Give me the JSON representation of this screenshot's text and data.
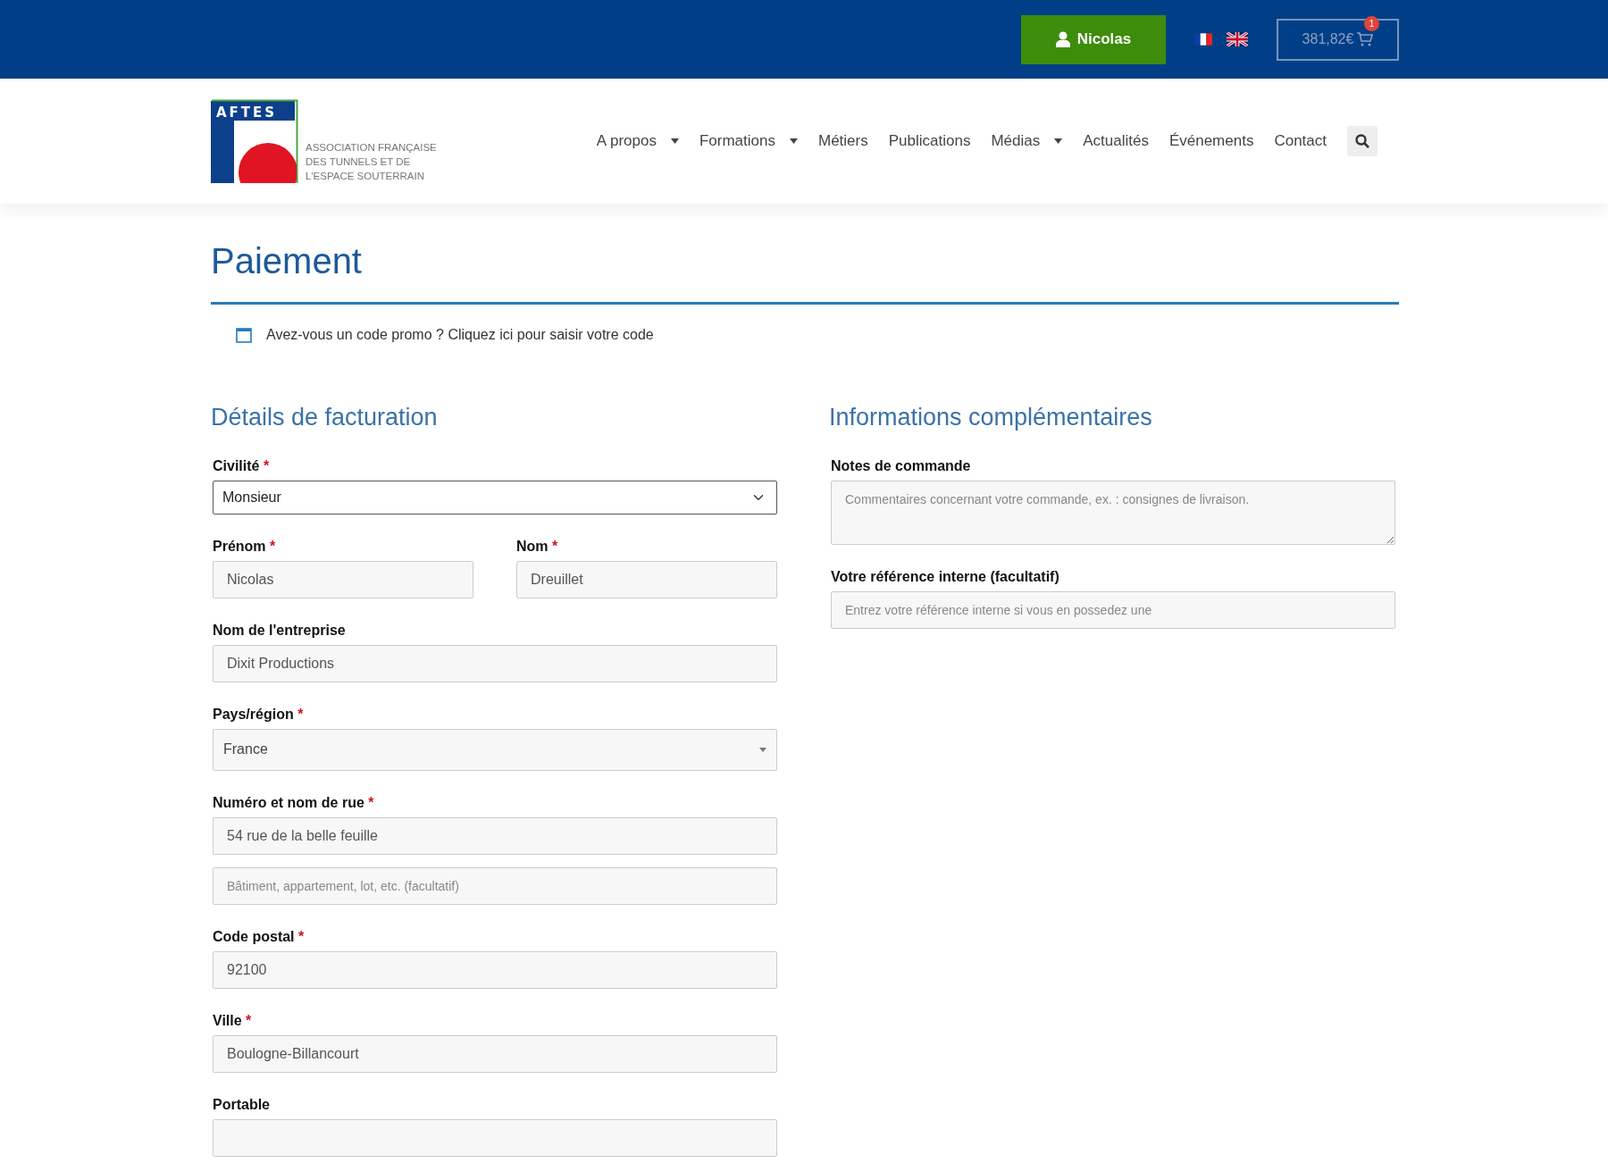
{
  "topbar": {
    "user_button": "Nicolas",
    "languages": [
      {
        "kind": "french"
      },
      {
        "kind": "english"
      }
    ],
    "cart": {
      "total": "381,82€",
      "count": "1"
    }
  },
  "header": {
    "logo": {
      "acronym": "AFTES",
      "lines": [
        "ASSOCIATION FRANÇAISE",
        "DES TUNNELS ET DE",
        "L'ESPACE SOUTERRAIN"
      ]
    },
    "nav": [
      {
        "label": "A propos",
        "has_menu": true
      },
      {
        "label": "Formations",
        "has_menu": true
      },
      {
        "label": "Métiers",
        "has_menu": false
      },
      {
        "label": "Publications",
        "has_menu": false
      },
      {
        "label": "Médias",
        "has_menu": true
      },
      {
        "label": "Actualités",
        "has_menu": false
      },
      {
        "label": "Événements",
        "has_menu": false
      },
      {
        "label": "Contact",
        "has_menu": false
      }
    ]
  },
  "page": {
    "title": "Paiement",
    "promo_notice": "Avez-vous un code promo ? Cliquez ici pour saisir votre code"
  },
  "billing": {
    "heading": "Détails de facturation",
    "rows": [
      {
        "fields": [
          {
            "kind": "select",
            "label": "Civilité",
            "mark": "*",
            "value": "Monsieur"
          }
        ]
      },
      {
        "fields": [
          {
            "kind": "text",
            "label": "Prénom",
            "mark": "*",
            "value": "Nicolas"
          },
          {
            "kind": "text",
            "label": "Nom",
            "mark": "*",
            "value": "Dreuillet"
          }
        ]
      },
      {
        "fields": [
          {
            "kind": "text",
            "label": "Nom de l'entreprise",
            "value": "Dixit Productions"
          }
        ]
      },
      {
        "fields": [
          {
            "kind": "dropdown",
            "label": "Pays/région",
            "mark": "*",
            "value": "France"
          }
        ]
      },
      {
        "fields": [
          {
            "kind": "text",
            "label": "Numéro et nom de rue",
            "mark": "*",
            "value": "54 rue de la belle feuille"
          }
        ]
      },
      {
        "fields": [
          {
            "kind": "text",
            "placeholder": "Bâtiment, appartement, lot, etc. (facultatif)"
          }
        ]
      },
      {
        "fields": [
          {
            "kind": "text",
            "label": "Code postal",
            "mark": "*",
            "value": "92100"
          }
        ]
      },
      {
        "fields": [
          {
            "kind": "text",
            "label": "Ville",
            "mark": "*",
            "value": "Boulogne-Billancourt"
          }
        ]
      },
      {
        "fields": [
          {
            "kind": "text",
            "label": "Portable"
          }
        ]
      }
    ]
  },
  "additional": {
    "heading": "Informations complémentaires",
    "rows": [
      {
        "fields": [
          {
            "kind": "textarea",
            "label": "Notes de commande",
            "placeholder": "Commentaires concernant votre commande, ex. : consignes de livraison."
          }
        ]
      },
      {
        "fields": [
          {
            "kind": "text",
            "label": "Votre référence interne (facultatif)",
            "placeholder": "Entrez votre référence interne si vous en possedez une"
          }
        ]
      }
    ]
  }
}
